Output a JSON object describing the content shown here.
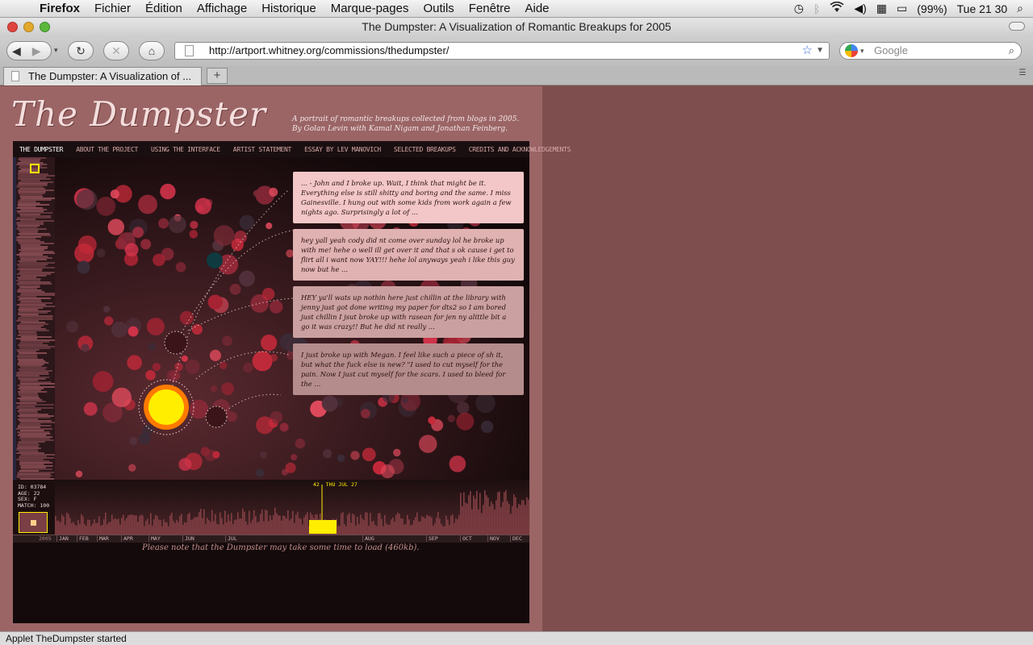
{
  "menubar": {
    "app": "Firefox",
    "menus": [
      "Fichier",
      "Édition",
      "Affichage",
      "Historique",
      "Marque-pages",
      "Outils",
      "Fenêtre",
      "Aide"
    ],
    "battery": "(99%)",
    "clock": "Tue 21 30"
  },
  "window": {
    "title": "The Dumpster: A Visualization of Romantic Breakups for 2005"
  },
  "toolbar": {
    "url": "http://artport.whitney.org/commissions/thedumpster/",
    "search_placeholder": "Google"
  },
  "tabs": [
    {
      "label": "The Dumpster: A Visualization of ..."
    }
  ],
  "page": {
    "logo": "The Dumpster",
    "subtitle_line1": "A portrait of romantic breakups collected from blogs in 2005.",
    "subtitle_line2": "By Golan Levin with Kamal Nigam and Jonathan Feinberg.",
    "nav": [
      "THE DUMPSTER",
      "ABOUT THE PROJECT",
      "USING THE INTERFACE",
      "ARTIST STATEMENT",
      "ESSAY BY LEV MANOVICH",
      "SELECTED BREAKUPS",
      "CREDITS AND ACKNOWLEDGEMENTS"
    ],
    "note": "Please note that the Dumpster may take some time to load (460kb)."
  },
  "cards": [
    {
      "text": "... - John and I broke up. Wait, I think that might be it. Everything else is still shitty and boring and the same. I miss Gainesville. I hung out with some kids from work again a few nights ago. Surprisingly a lot of ...",
      "bg": "#f3c7c7"
    },
    {
      "text": "hey yall yeah cody did nt come over sunday lol he broke up with me! hehe o well ill get over it and that s ok cause i get to flirt all i want now YAY!!! hehe lol anyways yeah i like this guy now but he ...",
      "bg": "#e0b2b2"
    },
    {
      "text": "HEY ya'll wats up nothin here just chillin at the library with jenny just got done writing my paper for dts2 so I am bored just chillin I jsut broke up with rasean for jen ny alittle bit a go it was crazy!! But he did nt really ...",
      "bg": "#caa0a0"
    },
    {
      "text": "I just broke up with Megan. I feel like such a piece of sh it, but what the fuck else is new? \"I used to cut myself for the pain. Now I just cut myself for the scars. I used to bleed for the ...",
      "bg": "#b58c8c"
    }
  ],
  "person": {
    "id": "ID: 03784",
    "age": "AGE: 22",
    "sex": "SEX: F",
    "match": "MATCH: 100"
  },
  "timeline": {
    "marker_count": "42",
    "marker_date": "THU JUL 27",
    "year": "2005",
    "months": [
      "JAN",
      "FEB",
      "MAR",
      "APR",
      "MAY",
      "JUN",
      "JUL",
      "AUG",
      "SEP",
      "OCT",
      "NOV",
      "DEC"
    ]
  },
  "status": "Applet TheDumpster started",
  "colors": {
    "page_bg": "#9b6566",
    "outer_bg": "#7e4e4e",
    "highlight": "#ffee00"
  }
}
